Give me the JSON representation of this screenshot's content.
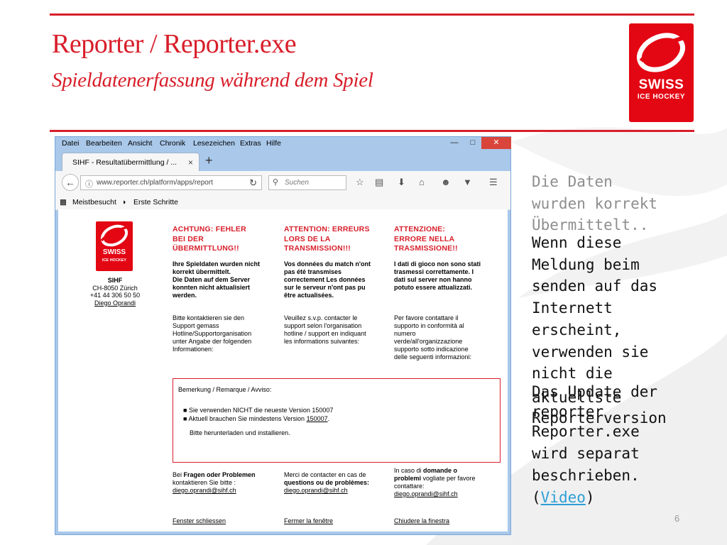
{
  "slide": {
    "title": "Reporter / Reporter.exe",
    "subtitle": "Spieldatenerfassung während dem Spiel",
    "logo": {
      "line1": "SWISS",
      "line2": "ICE HOCKEY"
    },
    "page_number": "6",
    "accent_color": "#d81e2a"
  },
  "browser": {
    "menu": [
      "Datei",
      "Bearbeiten",
      "Ansicht",
      "Chronik",
      "Lesezeichen",
      "Extras",
      "Hilfe"
    ],
    "window_controls": {
      "minimize": "—",
      "maximize": "□",
      "close": "✕"
    },
    "tab": {
      "title": "SIHF - Resultatübermittlung / ...",
      "close": "×"
    },
    "new_tab": "+",
    "url": "www.reporter.ch/platform/apps/report",
    "search_placeholder": "Suchen",
    "bookmarks": [
      "Meistbesucht",
      "Erste Schritte"
    ]
  },
  "page": {
    "logo": {
      "line1": "SWISS",
      "line2": "ICE HOCKEY"
    },
    "org": {
      "name": "SIHF",
      "city": "CH-8050 Zürich",
      "phone": "+41 44 306 50 50",
      "contact": "Diego Oprandi"
    },
    "de": {
      "heading1": "ACHTUNG: FEHLER",
      "heading2": "BEI DER",
      "heading3": "ÜBERMITTLUNG!!",
      "msg1": "Ihre Spieldaten wurden nicht",
      "msg2": "korrekt übermittelt.",
      "msg3": "Die Daten auf dem Server",
      "msg4": "konnten nicht aktualisiert",
      "msg5": "werden.",
      "sup1": "Bitte kontaktieren sie den",
      "sup2": "Support gemass",
      "sup3": "Hotline/Supportorganisation",
      "sup4": "unter Angabe der folgenden",
      "sup5": "Informationen:"
    },
    "fr": {
      "heading1": "ATTENTION: ERREURS",
      "heading2": "LORS DE LA",
      "heading3": "TRANSMISSION!!!",
      "msg1": "Vos données du match n'ont",
      "msg2": "pas été transmises",
      "msg3": "correctement Les données",
      "msg4": "sur le serveur n'ont pas pu",
      "msg5": "être actualisées.",
      "sup1": "Veuillez s.v.p. contacter le",
      "sup2": "support selon l'organisation",
      "sup3": "hotline / support en indiquant",
      "sup4": "les informations suivantes:"
    },
    "it": {
      "heading1": "ATTENZIONE:",
      "heading2": "ERRORE NELLA",
      "heading3": "TRASMISSIONE!!",
      "msg1": "I dati di gioco non sono stati",
      "msg2": "trasmessi correttamente. I",
      "msg3": "dati sul server non hanno",
      "msg4": "potuto essere attualizzati.",
      "sup1": "Per favore contattare il",
      "sup2": "supporto in conformità al",
      "sup3": "numero",
      "sup4": "verde/all'organizzazione",
      "sup5": "supporto sotto indicazione",
      "sup6": "delle seguenti informazioni:"
    },
    "remark": {
      "heading": "Bemerkung / Remarque / Avviso:",
      "bullet1": "Sie verwenden NICHT die neueste Version 150007",
      "bullet2_prefix": "Aktuell brauchen Sie mindestens Version ",
      "bullet2_link": "150007",
      "bullet2_suffix": ".",
      "instruction": "Bitte herunterladen und installieren."
    },
    "footer": {
      "de": {
        "l1a": "Bei ",
        "l1b": "Fragen oder Problemen",
        "l2": "kontaktieren Sie bitte :",
        "email": "diego.oprandi@sihf.ch",
        "close": "Fenster schliessen"
      },
      "fr": {
        "l1": "Merci de contacter en cas de",
        "l2": "questions ou de problèmes:",
        "email": "diego.oprandi@sihf.ch",
        "close": "Fermer la fenêtre"
      },
      "it": {
        "l1a": "In caso di ",
        "l1b": "domande o",
        "l2a": "problemi",
        "l2b": " vogliate per favore",
        "l3": "contattare:",
        "email": "diego.oprandi@sihf.ch",
        "close": "Chiudere la finestra"
      }
    }
  },
  "notes": {
    "gray_lines": [
      "Die Daten",
      "wurden korrekt",
      "Übermittelt.."
    ],
    "dark_lines": [
      "Wenn diese",
      "Meldung beim",
      "senden auf das",
      "Internett",
      "erscheint,",
      "verwenden sie",
      "nicht die",
      "aktuellste",
      "Reporterversion"
    ],
    "update_lines": [
      "Das Update der",
      "reporter",
      "Reporter.exe",
      "wird separat",
      "beschrieben."
    ],
    "video_open": "(",
    "video_link": "Video",
    "video_close": ")"
  }
}
